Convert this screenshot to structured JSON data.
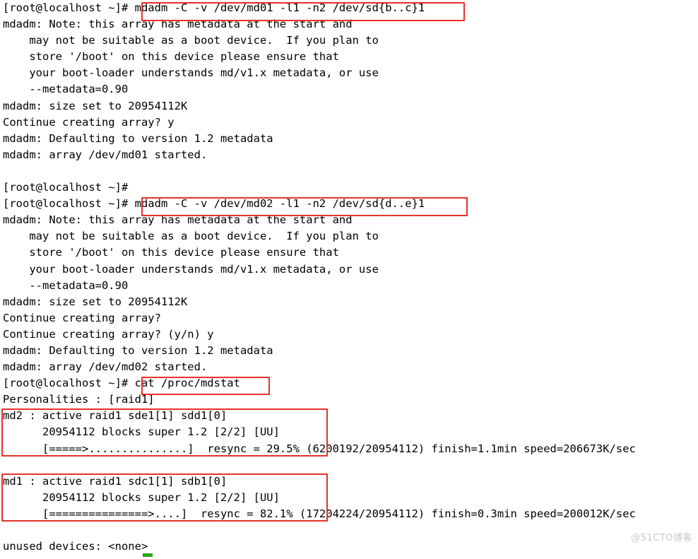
{
  "terminal": {
    "lines": [
      "[root@localhost ~]# mdadm -C -v /dev/md01 -l1 -n2 /dev/sd{b..c}1",
      "mdadm: Note: this array has metadata at the start and",
      "    may not be suitable as a boot device.  If you plan to",
      "    store '/boot' on this device please ensure that",
      "    your boot-loader understands md/v1.x metadata, or use",
      "    --metadata=0.90",
      "mdadm: size set to 20954112K",
      "Continue creating array? y",
      "mdadm: Defaulting to version 1.2 metadata",
      "mdadm: array /dev/md01 started.",
      "",
      "[root@localhost ~]#",
      "[root@localhost ~]# mdadm -C -v /dev/md02 -l1 -n2 /dev/sd{d..e}1",
      "mdadm: Note: this array has metadata at the start and",
      "    may not be suitable as a boot device.  If you plan to",
      "    store '/boot' on this device please ensure that",
      "    your boot-loader understands md/v1.x metadata, or use",
      "    --metadata=0.90",
      "mdadm: size set to 20954112K",
      "Continue creating array?",
      "Continue creating array? (y/n) y",
      "mdadm: Defaulting to version 1.2 metadata",
      "mdadm: array /dev/md02 started.",
      "[root@localhost ~]# cat /proc/mdstat",
      "Personalities : [raid1]",
      "md2 : active raid1 sde1[1] sdd1[0]",
      "      20954112 blocks super 1.2 [2/2] [UU]",
      "      [=====>...............]  resync = 29.5% (6200192/20954112) finish=1.1min speed=206673K/sec",
      "",
      "md1 : active raid1 sdc1[1] sdb1[0]",
      "      20954112 blocks super 1.2 [2/2] [UU]",
      "      [===============>....]  resync = 82.1% (17204224/20954112) finish=0.3min speed=200012K/sec",
      "",
      "unused devices: <none>"
    ]
  },
  "annotations": {
    "highlight_color": "#e8312a",
    "boxes": [
      {
        "name": "create-md01-command",
        "text": "mdadm -C -v /dev/md01 -l1 -n2 /dev/sd{b..c}1"
      },
      {
        "name": "create-md02-command",
        "text": "mdadm -C -v /dev/md02 -l1 -n2 /dev/sd{d..e}1"
      },
      {
        "name": "cat-mdstat-command",
        "text": "cat /proc/mdstat"
      },
      {
        "name": "md2-status-block",
        "text": "md2 : active raid1 sde1[1] sdd1[0]"
      },
      {
        "name": "md1-status-block",
        "text": "md1 : active raid1 sdc1[1] sdb1[0]"
      }
    ]
  },
  "watermark": {
    "text": "@51CTO博客"
  }
}
